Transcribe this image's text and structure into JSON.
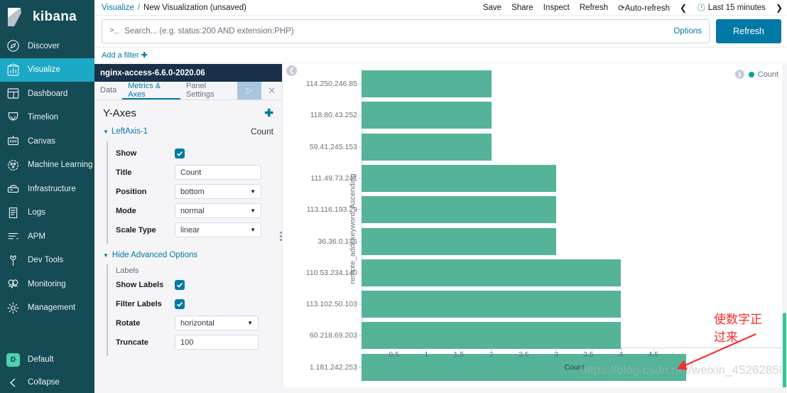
{
  "app": {
    "brand": "kibana"
  },
  "sidebar": {
    "items": [
      {
        "label": "Discover",
        "icon": "compass-icon",
        "active": false
      },
      {
        "label": "Visualize",
        "icon": "bar-chart-icon",
        "active": true
      },
      {
        "label": "Dashboard",
        "icon": "dashboard-icon",
        "active": false
      },
      {
        "label": "Timelion",
        "icon": "timelion-icon",
        "active": false
      },
      {
        "label": "Canvas",
        "icon": "canvas-icon",
        "active": false
      },
      {
        "label": "Machine Learning",
        "icon": "machine-learning-icon",
        "active": false
      },
      {
        "label": "Infrastructure",
        "icon": "infrastructure-icon",
        "active": false
      },
      {
        "label": "Logs",
        "icon": "logs-icon",
        "active": false
      },
      {
        "label": "APM",
        "icon": "apm-icon",
        "active": false
      },
      {
        "label": "Dev Tools",
        "icon": "wrench-icon",
        "active": false
      },
      {
        "label": "Monitoring",
        "icon": "monitoring-icon",
        "active": false
      },
      {
        "label": "Management",
        "icon": "gear-icon",
        "active": false
      }
    ],
    "space_badge": "D",
    "space_label": "Default",
    "collapse_label": "Collapse",
    "collapse_icon": "arrow-left-icon"
  },
  "breadcrumb": {
    "root": "Visualize",
    "separator": "/",
    "current": "New Visualization (unsaved)"
  },
  "topbar": {
    "save": "Save",
    "share": "Share",
    "inspect": "Inspect",
    "refresh": "Refresh",
    "auto_refresh": "Auto-refresh",
    "auto_refresh_icon": "refresh-cycle-icon",
    "prev_icon": "chevron-left-icon",
    "next_icon": "chevron-right-icon",
    "time_clock_icon": "clock-icon",
    "time_range": "Last 15 minutes"
  },
  "search": {
    "prompt": ">_",
    "placeholder": "Search... (e.g. status:200 AND extension:PHP)",
    "value": "",
    "options_label": "Options",
    "refresh_label": "Refresh"
  },
  "filters": {
    "add_filter_label": "Add a filter",
    "add_icon": "plus-icon"
  },
  "editor": {
    "index_title": "nginx-access-6.6.0-2020.06",
    "tabs": [
      {
        "label": "Data",
        "active": false
      },
      {
        "label": "Metrics & Axes",
        "active": true
      },
      {
        "label": "Panel Settings",
        "active": false
      }
    ],
    "apply_icon": "play-icon",
    "close_icon": "close-icon",
    "section_title": "Y-Axes",
    "add_icon": "plus-icon",
    "axis": {
      "name": "LeftAxis-1",
      "metric": "Count",
      "caret_icon": "caret-down-icon",
      "fields": [
        {
          "label": "Show",
          "type": "checkbox",
          "checked": true
        },
        {
          "label": "Title",
          "type": "text",
          "value": "Count"
        },
        {
          "label": "Position",
          "type": "select",
          "value": "bottom"
        },
        {
          "label": "Mode",
          "type": "select",
          "value": "normal"
        },
        {
          "label": "Scale Type",
          "type": "select",
          "value": "linear"
        }
      ]
    },
    "advanced_toggle": "Hide Advanced Options",
    "advanced_caret_icon": "caret-down-icon",
    "labels_group_title": "Labels",
    "label_fields": [
      {
        "label": "Show Labels",
        "type": "checkbox",
        "checked": true
      },
      {
        "label": "Filter Labels",
        "type": "checkbox",
        "checked": true
      },
      {
        "label": "Rotate",
        "type": "select",
        "value": "horizontal"
      },
      {
        "label": "Truncate",
        "type": "text",
        "value": "100"
      }
    ]
  },
  "chart_panel": {
    "collapse_icon": "chevron-left-circle-icon",
    "legend_toggle_icon": "chevron-right-circle-icon",
    "legend_label": "Count",
    "legend_color": "#00a69b",
    "annotation_text": "使数字正\n过来",
    "annotation_color": "#fa2b2b",
    "arrow_icon": "arrow-pointer-icon",
    "watermark": "https://blog.csdn.net/weixin_45262858"
  },
  "chart_data": {
    "type": "bar",
    "orientation": "horizontal",
    "title": "",
    "xlabel": "Count",
    "ylabel": "remote_addr.keyword: Ascending",
    "bar_color": "#54b399",
    "grid": false,
    "legend_position": "top-right",
    "series": [
      {
        "name": "Count",
        "values": [
          2,
          2,
          2,
          3,
          3,
          3,
          4,
          4,
          4,
          5
        ]
      }
    ],
    "categories": [
      "114.250.246.85",
      "118.80.43.252",
      "59.41.245.153",
      "111.49.73.241",
      "113.116.193.29",
      "36.36.0.146",
      "110.53.234.140",
      "113.102.50.103",
      "60.218.69.203",
      "1.181.242.253"
    ],
    "xticks": [
      "0.5",
      "1",
      "1.5",
      "2",
      "2.5",
      "3",
      "3.5",
      "4",
      "4.5"
    ],
    "xtick_values": [
      0.5,
      1,
      1.5,
      2,
      2.5,
      3,
      3.5,
      4,
      4.5
    ],
    "xlim": [
      0,
      5.2
    ],
    "ylim": null
  }
}
